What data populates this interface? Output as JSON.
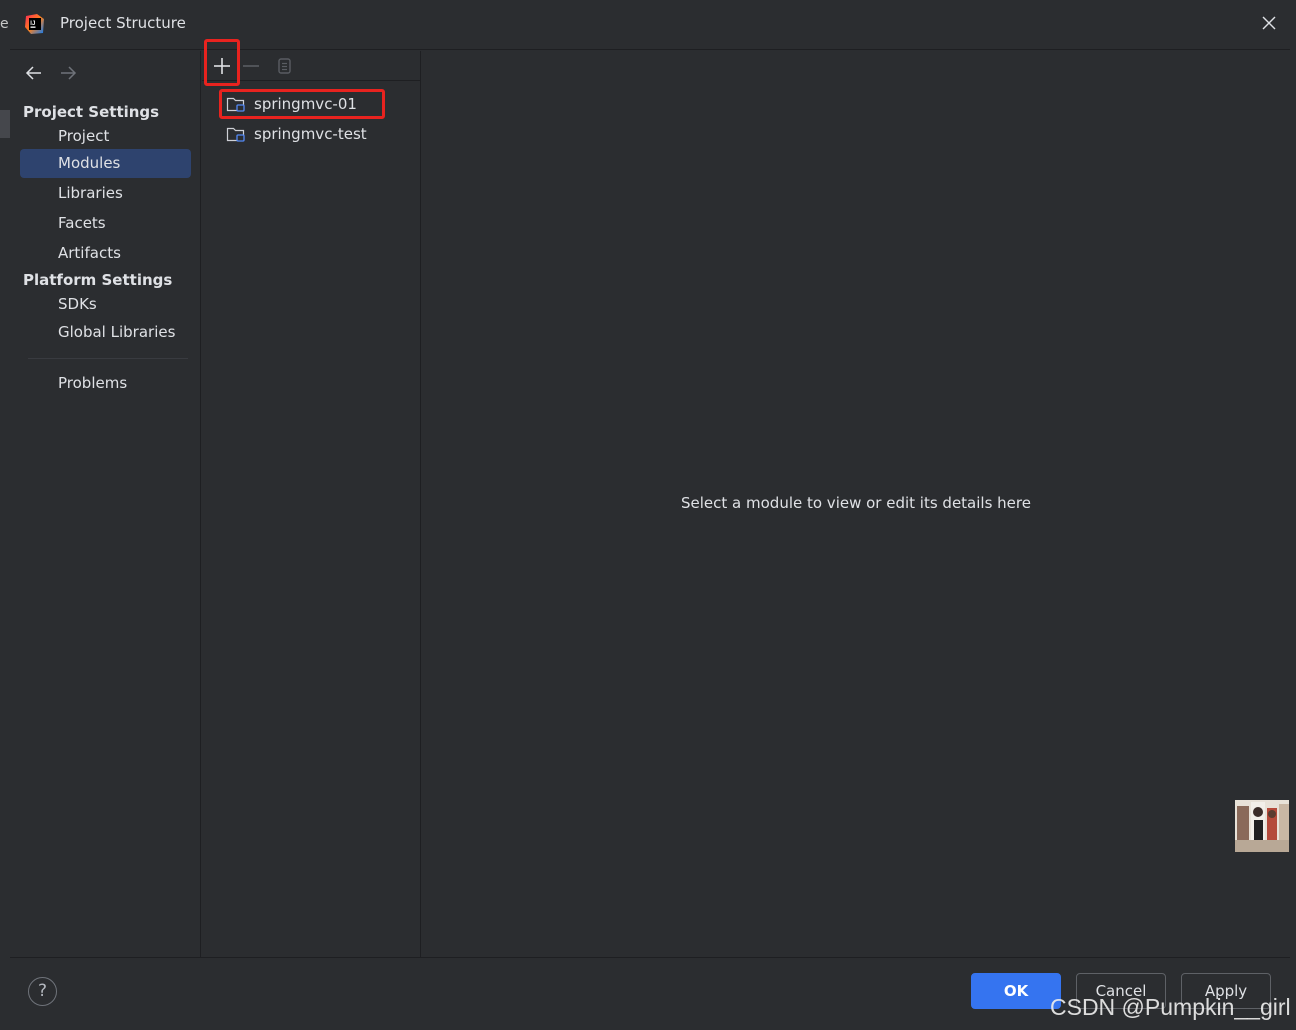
{
  "window": {
    "title": "Project Structure"
  },
  "background_fragment": "e",
  "sidebar": {
    "project_settings_heading": "Project Settings",
    "project_items": [
      {
        "label": "Project"
      },
      {
        "label": "Modules",
        "selected": true
      },
      {
        "label": "Libraries"
      },
      {
        "label": "Facets"
      },
      {
        "label": "Artifacts"
      }
    ],
    "platform_settings_heading": "Platform Settings",
    "platform_items": [
      {
        "label": "SDKs"
      },
      {
        "label": "Global Libraries"
      }
    ],
    "problems_label": "Problems"
  },
  "modules": {
    "items": [
      {
        "label": "springmvc-01",
        "highlighted": true
      },
      {
        "label": "springmvc-test"
      }
    ]
  },
  "details": {
    "empty_message": "Select a module to view or edit its details here"
  },
  "footer": {
    "help_label": "?",
    "ok_label": "OK",
    "cancel_label": "Cancel",
    "apply_label": "Apply"
  },
  "watermark": "CSDN @Pumpkin__girl",
  "colors": {
    "accent": "#3574f0",
    "selection": "#2e436e",
    "highlight_box": "#e8231f",
    "panel_bg": "#2b2d30"
  }
}
